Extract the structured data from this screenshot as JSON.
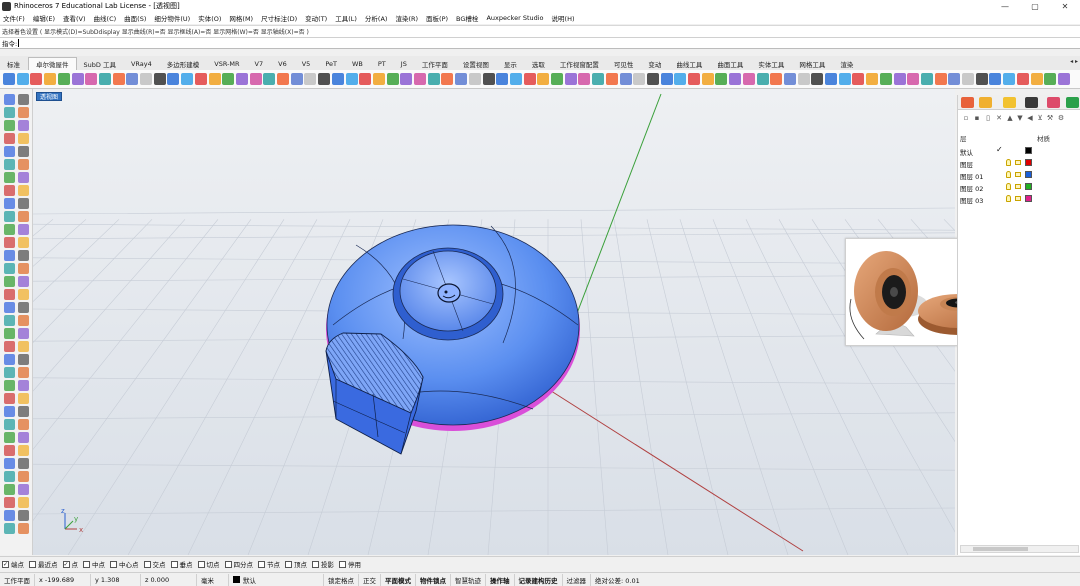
{
  "window": {
    "title": "Rhinoceros 7 Educational Lab License - [透视图]",
    "controls": [
      "—",
      "▢",
      "✕"
    ]
  },
  "menu": [
    "文件(F)",
    "编辑(E)",
    "查看(V)",
    "曲线(C)",
    "曲面(S)",
    "细分物件(U)",
    "实体(O)",
    "网格(M)",
    "尺寸标注(D)",
    "变动(T)",
    "工具(L)",
    "分析(A)",
    "渲染(R)",
    "面板(P)",
    "BG槽栓",
    "Auxpecker Studio",
    "说明(H)"
  ],
  "command": {
    "history": "选择着色设置 ( 显示模式(D)=SubDdisplay  显示曲线(R)=否  显示框线(A)=否  显示网格(W)=否  显示轴线(X)=否 )",
    "prompt": "指令:",
    "value": ""
  },
  "tabs": [
    "标准",
    "卓尔微屋件",
    "SubD 工具",
    "VRay4",
    "多边形建模",
    "VSR-MR",
    "V7",
    "V6",
    "V5",
    "PeT",
    "WB",
    "PT",
    "JS",
    "工作平面",
    "设置视图",
    "显示",
    "选取",
    "工作视窗配置",
    "可见性",
    "变动",
    "曲线工具",
    "曲面工具",
    "实体工具",
    "网格工具",
    "渲染"
  ],
  "active_tab": "卓尔微屋件",
  "viewport": {
    "label": "透视图",
    "axis_labels": {
      "z": "z",
      "y": "y",
      "x": "x"
    }
  },
  "layers": {
    "header_name": "层",
    "header_material": "材质",
    "rows": [
      {
        "name": "默认",
        "current": true,
        "color": "#000000"
      },
      {
        "name": "图层",
        "current": false,
        "color": "#e00000"
      },
      {
        "name": "图层 01",
        "current": false,
        "color": "#1a5fd8"
      },
      {
        "name": "图层 02",
        "current": false,
        "color": "#22b022"
      },
      {
        "name": "图层 03",
        "current": false,
        "color": "#e0208a"
      }
    ]
  },
  "osnaps": [
    {
      "label": "端点",
      "checked": true
    },
    {
      "label": "最近点",
      "checked": false
    },
    {
      "label": "点",
      "checked": true
    },
    {
      "label": "中点",
      "checked": false
    },
    {
      "label": "中心点",
      "checked": false
    },
    {
      "label": "交点",
      "checked": false
    },
    {
      "label": "垂点",
      "checked": false
    },
    {
      "label": "切点",
      "checked": false
    },
    {
      "label": "四分点",
      "checked": false
    },
    {
      "label": "节点",
      "checked": false
    },
    {
      "label": "顶点",
      "checked": false
    },
    {
      "label": "投影",
      "checked": false
    },
    {
      "label": "停用",
      "checked": false
    }
  ],
  "status": {
    "cplane": "工作平面",
    "x": "x -199.689",
    "y": "y 1.308",
    "z": "z 0.000",
    "units": "毫米",
    "layer": "默认",
    "grid_snap": "锁定格点",
    "ortho": "正交",
    "planar": "平面模式",
    "osnap": "物件锁点",
    "smarttrack": "智慧轨迹",
    "gumball": "操作轴",
    "history": "记录建构历史",
    "filter": "过滤器",
    "tolerance": "绝对公差: 0.01"
  },
  "colors": {
    "accent": "#3373c0",
    "object": "#5b8ff0",
    "grid": "#c6ccd6",
    "x_axis": "#b04040",
    "y_axis": "#3aa03a"
  }
}
